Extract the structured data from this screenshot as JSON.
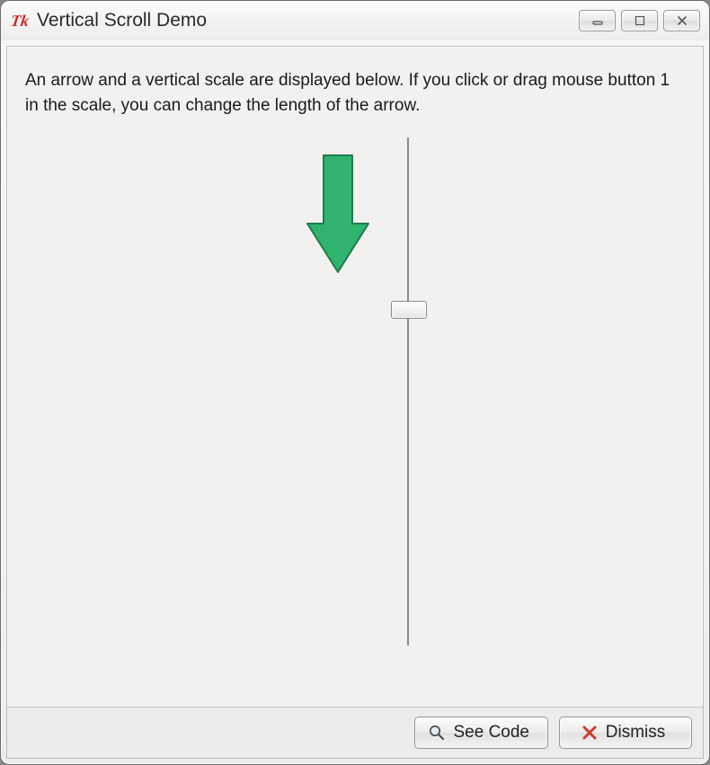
{
  "window": {
    "title": "Vertical Scroll Demo"
  },
  "description": "An arrow and a vertical scale are displayed below. If you click or drag mouse button 1 in the scale, you can change the length of the arrow.",
  "arrow": {
    "color": "#2fb36e",
    "stroke": "#1e7b4a"
  },
  "buttons": {
    "see_code": "See Code",
    "dismiss": "Dismiss"
  }
}
